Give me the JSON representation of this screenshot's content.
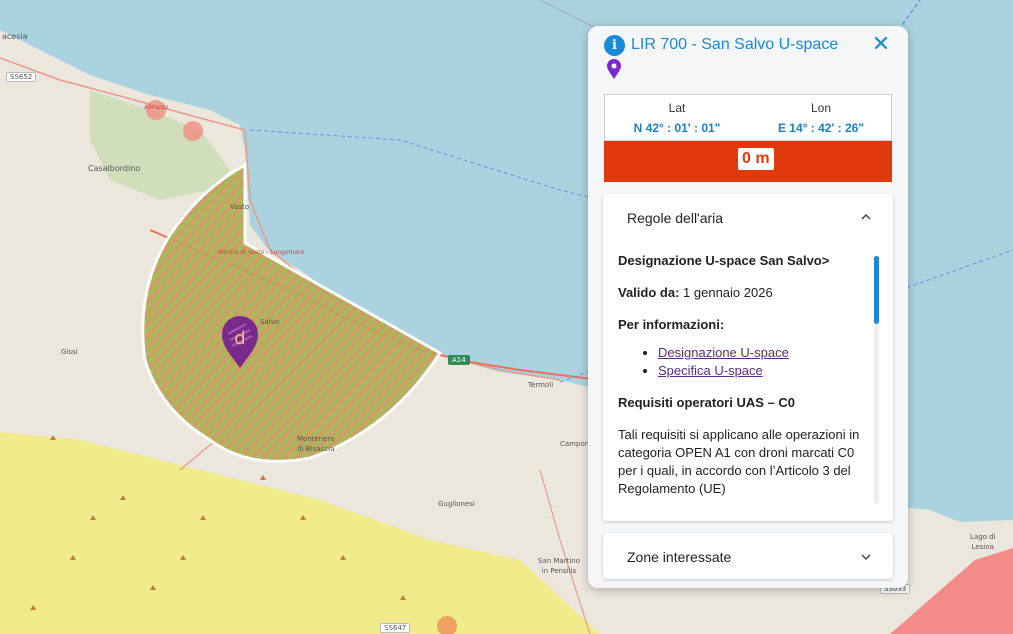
{
  "map": {
    "places": {
      "vasto": "Vasto",
      "casalbordino": "Casalbordino",
      "salvo": "Salvo",
      "gissi": "Gissi",
      "montenero": "Montenero",
      "montenero_2": "di Bisaccia",
      "termoli": "Termoli",
      "campomarino": "Campomarino",
      "guglionesi": "Guglionesi",
      "sanmartino": "San Martino",
      "sanmartino_2": "in Pensilis",
      "lungomare": "Marina di Vasto - Lungomare",
      "acesia": "acesia",
      "lago": "Lago di",
      "lago_2": "Lesina",
      "abruzzo": "Abruzzo"
    },
    "roads": {
      "ss652": "SS652",
      "a14": "A14",
      "ss647": "SS647",
      "ss693": "SS693"
    },
    "colors": {
      "sea": "#aad3df",
      "land": "#ece7dd",
      "zone": "#c89a5e",
      "zone_stripe": "#8fbf3a",
      "yellow": "#f2eb8c",
      "red_zone": "#f56c6c"
    }
  },
  "panel": {
    "title": "LIR 700 - San Salvo U-space",
    "close_icon": "close-icon",
    "coords": {
      "lat_label": "Lat",
      "lon_label": "Lon",
      "lat_value": "N 42° : 01' : 01\"",
      "lon_value": "E 14° : 42' : 26\""
    },
    "altitude": "0 m",
    "sections": {
      "rules_title": "Regole dell'aria",
      "zones_title": "Zone interessate"
    },
    "rules": {
      "designation": "Designazione U-space San Salvo>",
      "valid_label": "Valido da:",
      "valid_value": "1 gennaio 2026",
      "info_label": "Per informazioni:",
      "link1": "Designazione U-space",
      "link2": "Specifica U-space",
      "requirements_title": "Requisiti operatori UAS – C0",
      "requirements_text": "Tali requisiti si applicano alle operazioni in categoria OPEN A1 con droni marcati C0 per i quali, in accordo con l’Articolo 3 del Regolamento (UE)"
    }
  }
}
